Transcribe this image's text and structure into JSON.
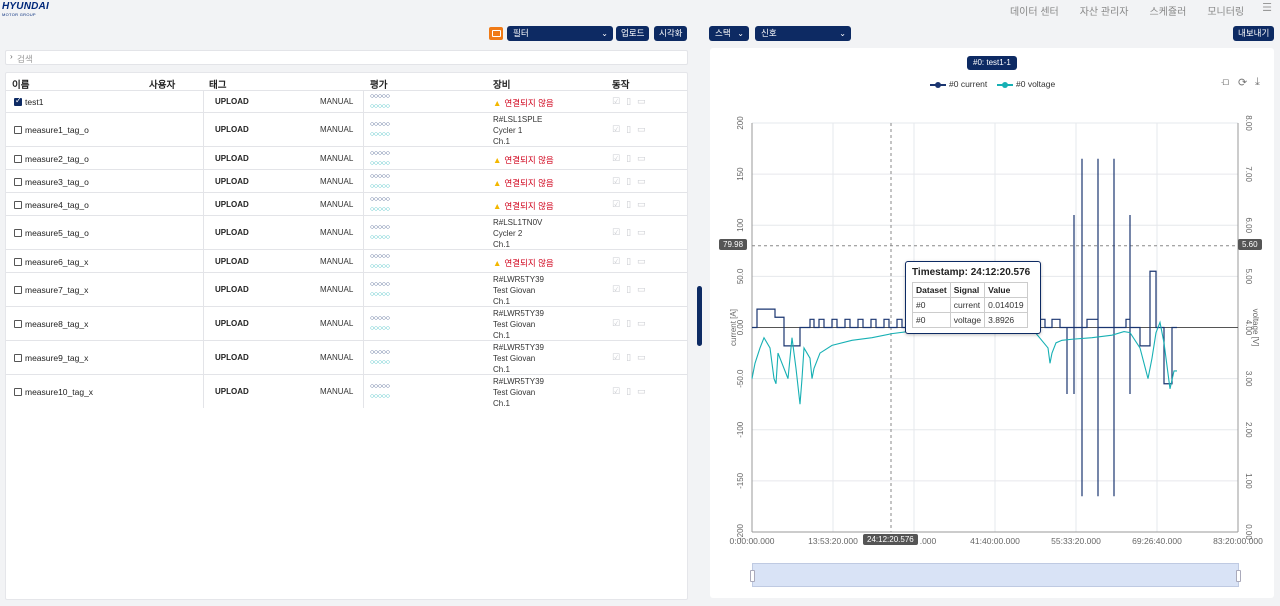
{
  "brand": {
    "name": "HYUNDAI",
    "sub": "MOTOR GROUP"
  },
  "nav": {
    "items": [
      "데이터 센터",
      "자산 관리자",
      "스케쥴러",
      "모니터링"
    ],
    "menu_icon": "☰"
  },
  "toolbar": {
    "filter_label": "필터",
    "upload_label": "업로드",
    "visualize_label": "시각화",
    "stack_label": "스택",
    "signal_label": "신호",
    "export_label": "내보내기"
  },
  "search": {
    "label": "검색"
  },
  "table": {
    "headers": {
      "name": "이름",
      "user": "사용자",
      "tag": "태그",
      "rating": "평가",
      "equipment": "장비",
      "action": "동작"
    },
    "rating_marks": "○○○○○",
    "rows": [
      {
        "name": "test1",
        "checked": true,
        "upload": "UPLOAD",
        "manual": "MANUAL",
        "status": "warn",
        "warn": "연결되지 않음",
        "equip": []
      },
      {
        "name": "measure1_tag_o",
        "checked": false,
        "upload": "UPLOAD",
        "manual": "MANUAL",
        "status": "equip",
        "warn": "",
        "equip": [
          "R#LSL1SPLE",
          "Cycler 1",
          "Ch.1"
        ]
      },
      {
        "name": "measure2_tag_o",
        "checked": false,
        "upload": "UPLOAD",
        "manual": "MANUAL",
        "status": "warn",
        "warn": "연결되지 않음",
        "equip": []
      },
      {
        "name": "measure3_tag_o",
        "checked": false,
        "upload": "UPLOAD",
        "manual": "MANUAL",
        "status": "warn",
        "warn": "연결되지 않음",
        "equip": []
      },
      {
        "name": "measure4_tag_o",
        "checked": false,
        "upload": "UPLOAD",
        "manual": "MANUAL",
        "status": "warn",
        "warn": "연결되지 않음",
        "equip": []
      },
      {
        "name": "measure5_tag_o",
        "checked": false,
        "upload": "UPLOAD",
        "manual": "MANUAL",
        "status": "equip",
        "warn": "",
        "equip": [
          "R#LSL1TN0V",
          "Cycler 2",
          "Ch.1"
        ]
      },
      {
        "name": "measure6_tag_x",
        "checked": false,
        "upload": "UPLOAD",
        "manual": "MANUAL",
        "status": "warn",
        "warn": "연결되지 않음",
        "equip": []
      },
      {
        "name": "measure7_tag_x",
        "checked": false,
        "upload": "UPLOAD",
        "manual": "MANUAL",
        "status": "equip",
        "warn": "",
        "equip": [
          "R#LWR5TY39",
          "Test Giovan",
          "Ch.1"
        ]
      },
      {
        "name": "measure8_tag_x",
        "checked": false,
        "upload": "UPLOAD",
        "manual": "MANUAL",
        "status": "equip",
        "warn": "",
        "equip": [
          "R#LWR5TY39",
          "Test Giovan",
          "Ch.1"
        ]
      },
      {
        "name": "measure9_tag_x",
        "checked": false,
        "upload": "UPLOAD",
        "manual": "MANUAL",
        "status": "equip",
        "warn": "",
        "equip": [
          "R#LWR5TY39",
          "Test Giovan",
          "Ch.1"
        ]
      },
      {
        "name": "measure10_tag_x",
        "checked": false,
        "upload": "UPLOAD",
        "manual": "MANUAL",
        "status": "equip",
        "warn": "",
        "equip": [
          "R#LWR5TY39",
          "Test Giovan",
          "Ch.1"
        ]
      }
    ]
  },
  "chart_tab": "#0: test1-1",
  "tooltip": {
    "title": "Timestamp: 24:12:20.576",
    "headers": [
      "Dataset",
      "Signal",
      "Value"
    ],
    "rows": [
      [
        "#0",
        "current",
        "0.014019"
      ],
      [
        "#0",
        "voltage",
        "3.8926"
      ]
    ]
  },
  "colors": {
    "navy": "#0d2a63",
    "teal": "#17b0b4",
    "warn": "#d0021b",
    "current": "#1a3570",
    "voltage": "#17b0b4"
  },
  "chart_data": {
    "type": "line",
    "series": [
      {
        "name": "#0 current",
        "axis": "left",
        "color": "#1a3570"
      },
      {
        "name": "#0 voltage",
        "axis": "right",
        "color": "#17b0b4"
      }
    ],
    "ylabel_left": "current [A]",
    "ylabel_right": "voltage [V]",
    "ylim_left": [
      -200,
      200
    ],
    "ylim_right": [
      0,
      8
    ],
    "yticks_left": [
      "200",
      "150",
      "100",
      "50.0",
      "0.00",
      "-50.0",
      "-100",
      "-150",
      "-200"
    ],
    "yticks_right": [
      "8.00",
      "7.00",
      "6.00",
      "5.00",
      "4.00",
      "3.00",
      "2.00",
      "1.00",
      "0.00"
    ],
    "xticks": [
      "0:00:00.000",
      "13:53:20.000",
      "27:46:40.000",
      "41:40:00.000",
      "55:33:20.000",
      "69:26:40.000",
      "83:20:00.000"
    ],
    "xticks_visible": [
      "0:00:00.000",
      "13:53:20.000",
      ".000",
      "41:40:00.000",
      "55:33:20.000",
      "69:26:40.000",
      "83:20:00.000"
    ],
    "crosshair": {
      "x_label": "24:12:20.576",
      "left_label": "79.98",
      "right_label": "5.60"
    },
    "grid": true,
    "legend": "top-center"
  }
}
